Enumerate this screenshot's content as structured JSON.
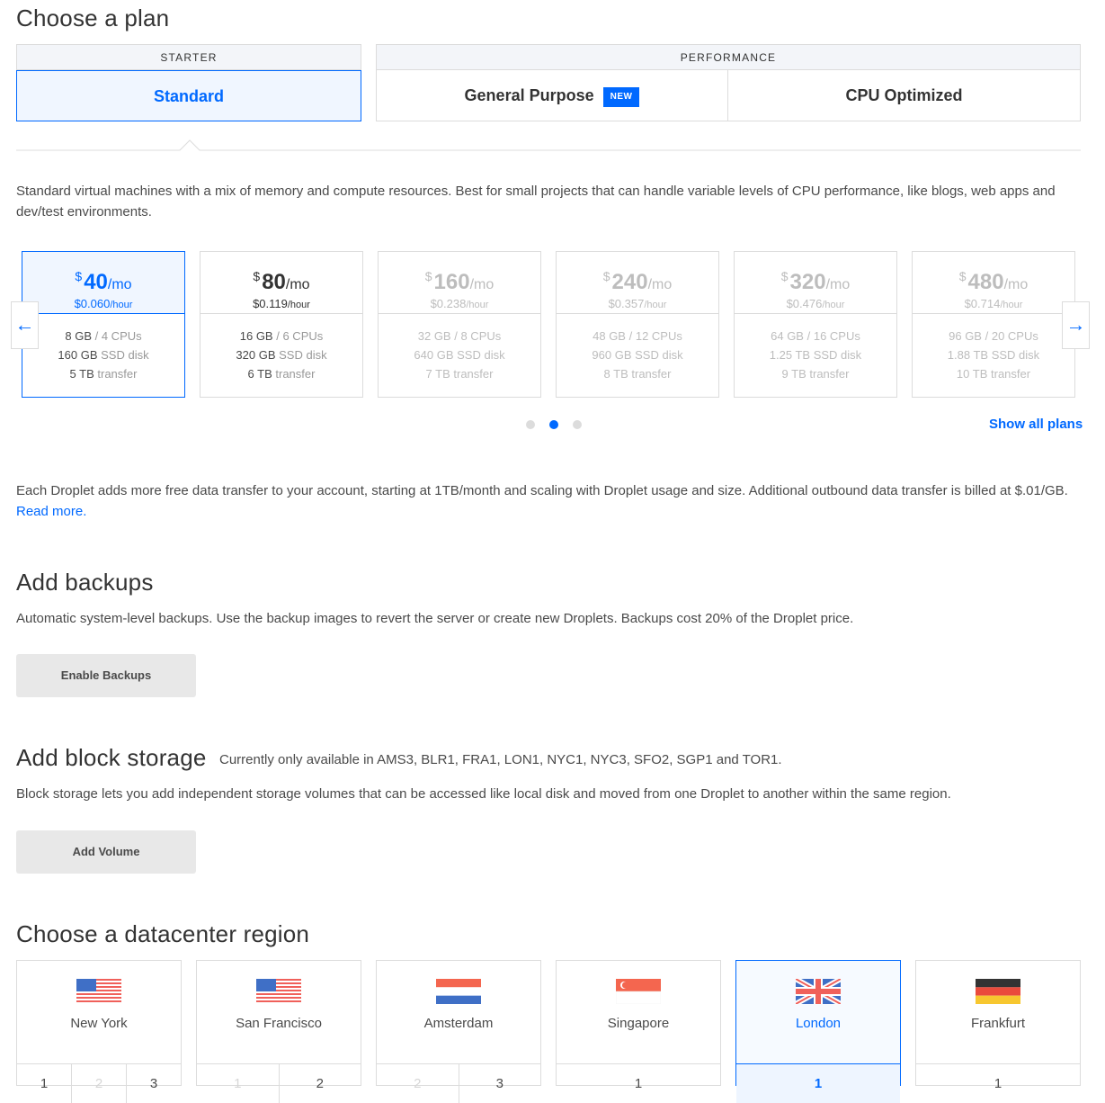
{
  "plan_section": {
    "title": "Choose a plan",
    "groups": {
      "starter": "STARTER",
      "performance": "PERFORMANCE"
    },
    "tabs": {
      "standard": "Standard",
      "general_purpose": "General Purpose",
      "new_badge": "NEW",
      "cpu_optimized": "CPU Optimized"
    },
    "description": "Standard virtual machines with a mix of memory and compute resources. Best for small projects that can handle variable levels of CPU performance, like blogs, web apps and dev/test environments.",
    "show_all": "Show all plans",
    "transfer_note": "Each Droplet adds more free data transfer to your account, starting at 1TB/month and scaling with Droplet usage and size. Additional outbound data transfer is billed at $.01/GB.",
    "read_more": "Read more.",
    "carousel": {
      "prev": "←",
      "next": "→",
      "pages": 3,
      "current_page": 2
    },
    "cards": [
      {
        "currency": "$",
        "price": "40",
        "per": "/mo",
        "hourly": "$0.060",
        "per_hour": "/hour",
        "mem": "8 GB",
        "cpus": "/ 4 CPUs",
        "disk": "160 GB",
        "disk_label": "SSD disk",
        "transfer": "5 TB",
        "transfer_label": "transfer",
        "state": "selected"
      },
      {
        "currency": "$",
        "price": "80",
        "per": "/mo",
        "hourly": "$0.119",
        "per_hour": "/hour",
        "mem": "16 GB",
        "cpus": "/ 6 CPUs",
        "disk": "320 GB",
        "disk_label": "SSD disk",
        "transfer": "6 TB",
        "transfer_label": "transfer",
        "state": "available"
      },
      {
        "currency": "$",
        "price": "160",
        "per": "/mo",
        "hourly": "$0.238",
        "per_hour": "/hour",
        "mem": "32 GB",
        "cpus": "/ 8 CPUs",
        "disk": "640 GB",
        "disk_label": "SSD disk",
        "transfer": "7 TB",
        "transfer_label": "transfer",
        "state": "disabled"
      },
      {
        "currency": "$",
        "price": "240",
        "per": "/mo",
        "hourly": "$0.357",
        "per_hour": "/hour",
        "mem": "48 GB",
        "cpus": "/ 12 CPUs",
        "disk": "960 GB",
        "disk_label": "SSD disk",
        "transfer": "8 TB",
        "transfer_label": "transfer",
        "state": "disabled"
      },
      {
        "currency": "$",
        "price": "320",
        "per": "/mo",
        "hourly": "$0.476",
        "per_hour": "/hour",
        "mem": "64 GB",
        "cpus": "/ 16 CPUs",
        "disk": "1.25 TB",
        "disk_label": "SSD disk",
        "transfer": "9 TB",
        "transfer_label": "transfer",
        "state": "disabled"
      },
      {
        "currency": "$",
        "price": "480",
        "per": "/mo",
        "hourly": "$0.714",
        "per_hour": "/hour",
        "mem": "96 GB",
        "cpus": "/ 20 CPUs",
        "disk": "1.88 TB",
        "disk_label": "SSD disk",
        "transfer": "10 TB",
        "transfer_label": "transfer",
        "state": "disabled"
      }
    ]
  },
  "backups": {
    "title": "Add backups",
    "description": "Automatic system-level backups. Use the backup images to revert the server or create new Droplets. Backups cost 20% of the Droplet price.",
    "button": "Enable Backups"
  },
  "block_storage": {
    "title": "Add block storage",
    "availability": "Currently only available in AMS3, BLR1, FRA1, LON1, NYC1, NYC3, SFO2, SGP1 and TOR1.",
    "description": "Block storage lets you add independent storage volumes that can be accessed like local disk and moved from one Droplet to another within the same region.",
    "button": "Add Volume"
  },
  "regions": {
    "title": "Choose a datacenter region",
    "items": [
      {
        "name": "New York",
        "flag": "us-flag-icon",
        "numbers": [
          "1",
          "2",
          "3"
        ],
        "disabled": [
          false,
          true,
          false
        ],
        "selected": false
      },
      {
        "name": "San Francisco",
        "flag": "us-flag-icon",
        "numbers": [
          "1",
          "2"
        ],
        "disabled": [
          true,
          false
        ],
        "selected": false
      },
      {
        "name": "Amsterdam",
        "flag": "nl-flag-icon",
        "numbers": [
          "2",
          "3"
        ],
        "disabled": [
          true,
          false
        ],
        "selected": false
      },
      {
        "name": "Singapore",
        "flag": "sg-flag-icon",
        "numbers": [
          "1"
        ],
        "disabled": [
          false
        ],
        "selected": false
      },
      {
        "name": "London",
        "flag": "uk-flag-icon",
        "numbers": [
          "1"
        ],
        "disabled": [
          false
        ],
        "selected": true
      },
      {
        "name": "Frankfurt",
        "flag": "de-flag-icon",
        "numbers": [
          "1"
        ],
        "disabled": [
          false
        ],
        "selected": false
      }
    ]
  },
  "colors": {
    "accent": "#0069ff",
    "border": "#dcdcdc",
    "selected_bg": "#f0f6ff",
    "button_bg": "#e8e8e8"
  }
}
